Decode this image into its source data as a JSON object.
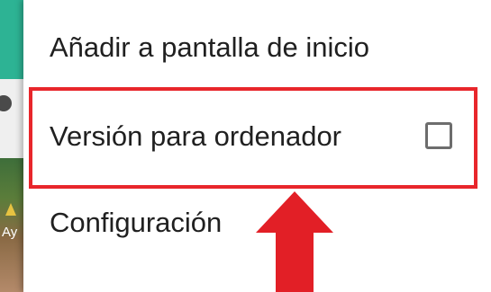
{
  "background": {
    "partial_text": "Ay"
  },
  "menu": {
    "items": [
      {
        "label": "Añadir a pantalla de inicio"
      },
      {
        "label": "Versión para ordenador",
        "checkbox_checked": false
      },
      {
        "label": "Configuración"
      }
    ]
  },
  "annotation": {
    "highlight_color": "#e8262b",
    "arrow_color": "#e21f26",
    "arrow_direction": "up"
  }
}
